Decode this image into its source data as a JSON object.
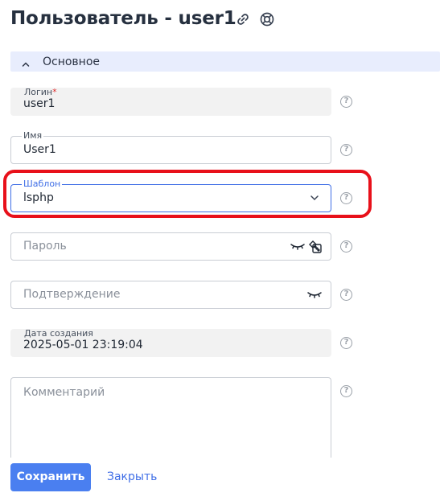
{
  "header": {
    "title": "Пользователь - user1",
    "icons": [
      "link-icon",
      "help-lifebuoy-icon"
    ]
  },
  "section": {
    "label": "Основное",
    "expanded": true
  },
  "fields": {
    "login": {
      "label": "Логин",
      "required_mark": "*",
      "value": "user1",
      "readonly": true
    },
    "name": {
      "label": "Имя",
      "value": "User1"
    },
    "template": {
      "label": "Шаблон",
      "value": "lsphp",
      "focused": true
    },
    "password": {
      "placeholder": "Пароль"
    },
    "confirm": {
      "placeholder": "Подтверждение"
    },
    "created": {
      "label": "Дата создания",
      "value": "2025-05-01 23:19:04",
      "readonly": true
    },
    "comment": {
      "placeholder": "Комментарий"
    }
  },
  "help_glyph": "?",
  "buttons": {
    "save": "Сохранить",
    "close": "Закрыть"
  },
  "colors": {
    "accent": "#3f6ee6",
    "save_button": "#4a7ff0",
    "section_bg": "#e8edfd",
    "highlight": "#e8101a",
    "required": "#e02a2a"
  }
}
